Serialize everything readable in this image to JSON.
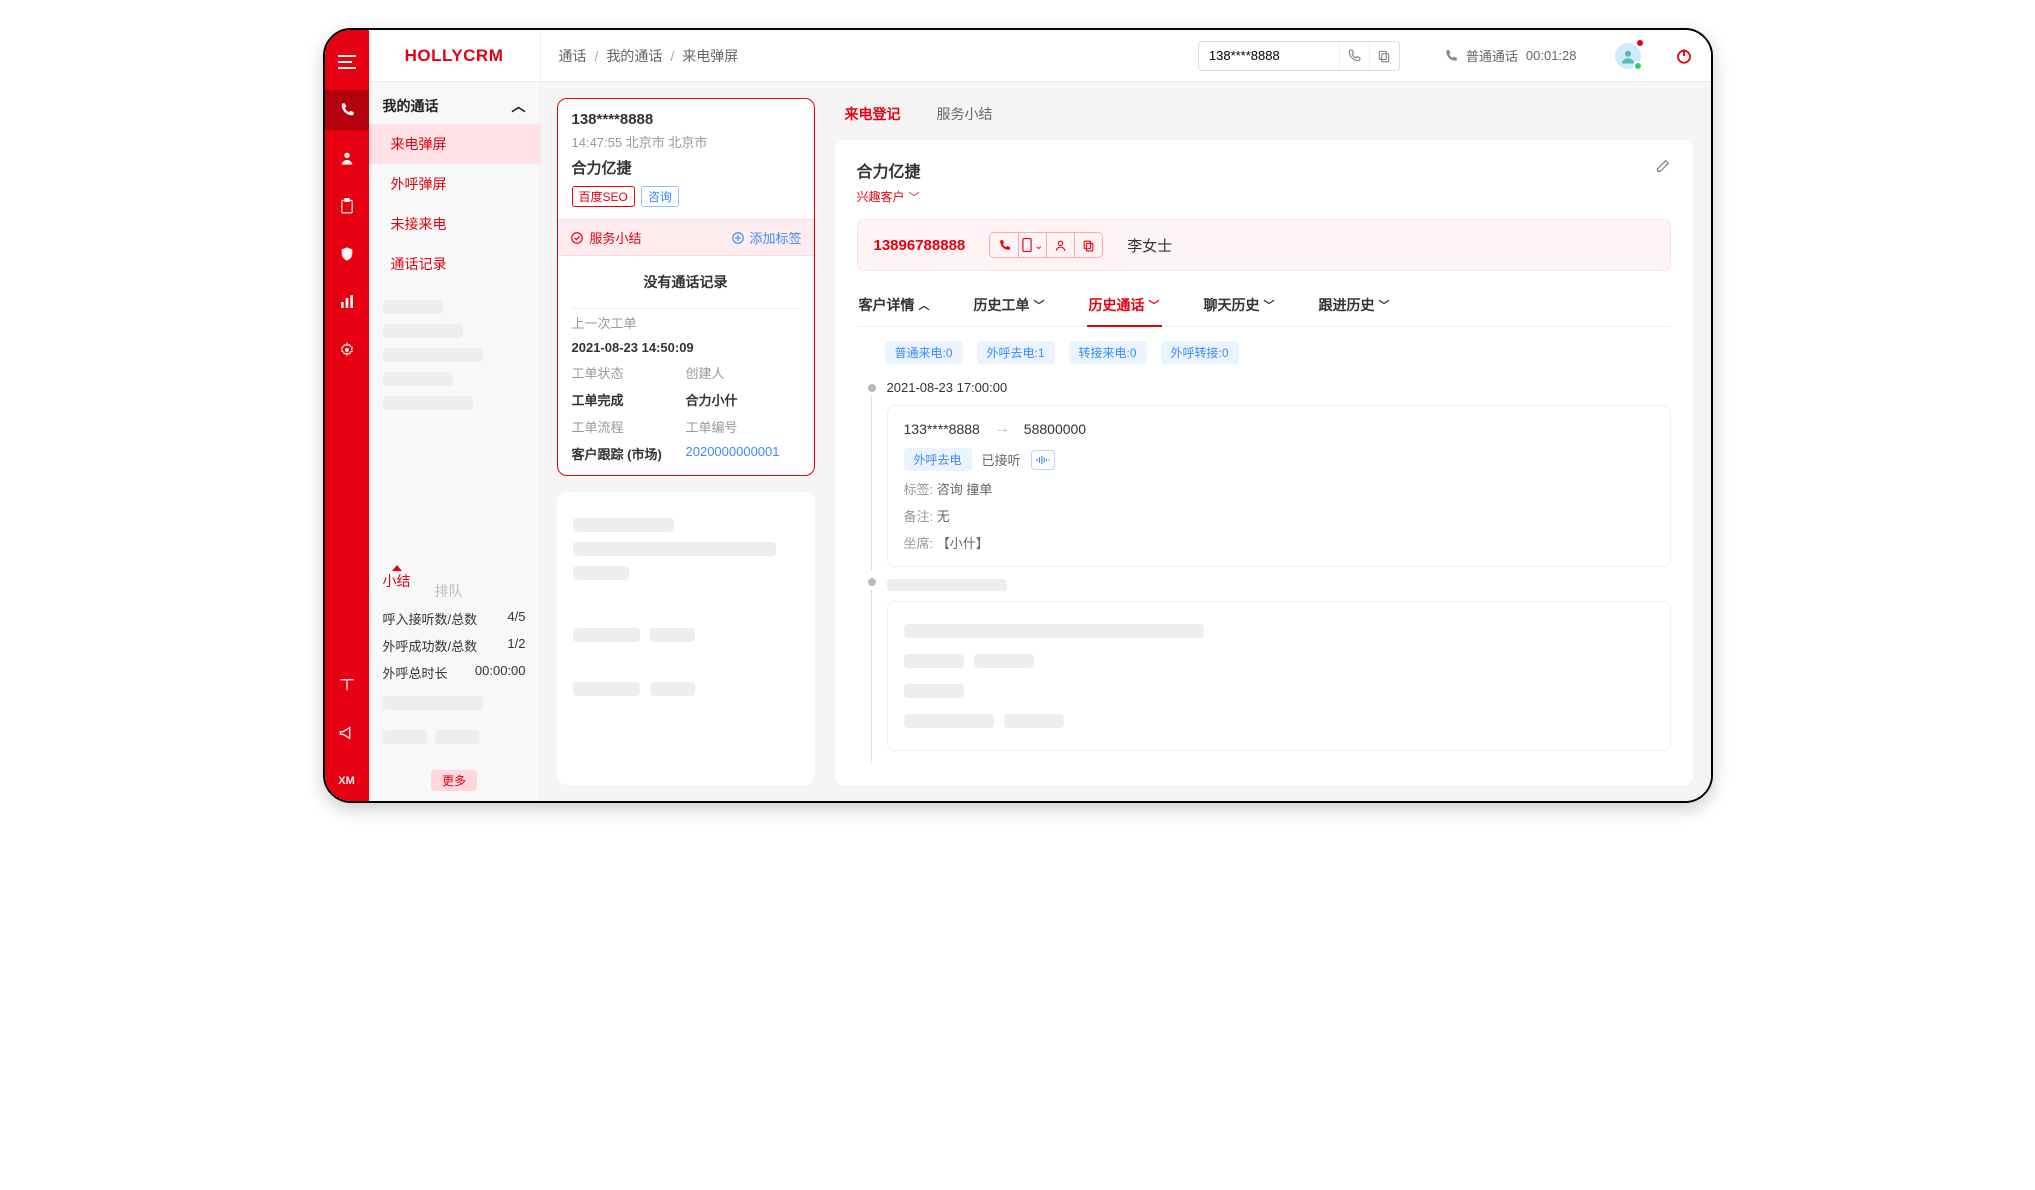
{
  "brand": "HOLLYCRM",
  "breadcrumbs": [
    "通话",
    "我的通话",
    "来电弹屏"
  ],
  "search_value": "138****8888",
  "call_status": {
    "label": "普通通话",
    "timer": "00:01:28"
  },
  "sidebar": {
    "group_title": "我的通话",
    "items": [
      "来电弹屏",
      "外呼弹屏",
      "未接来电",
      "通话记录"
    ]
  },
  "mini_tabs": {
    "summary": "小结",
    "queue": "排队"
  },
  "stats": {
    "r1_label": "呼入接听数/总数",
    "r1_value": "4/5",
    "r2_label": "外呼成功数/总数",
    "r2_value": "1/2",
    "r3_label": "外呼总时长",
    "r3_value": "00:00:00",
    "more": "更多"
  },
  "call_card": {
    "number": "138****8888",
    "time_loc": "14:47:55 北京市  北京市",
    "company": "合力亿捷",
    "tags": [
      "百度SEO",
      "咨询"
    ],
    "band_left": "服务小结",
    "band_right": "添加标签",
    "empty": "没有通话记录",
    "last_label": "上一次工单",
    "last_time": "2021-08-23 14:50:09",
    "k_status": "工单状态",
    "v_status_k": "创建人",
    "k_done": "工单完成",
    "v_done": "合力小什",
    "k_flow": "工单流程",
    "v_flow_k": "工单编号",
    "k_track": "客户跟踪 (市场)",
    "v_track": "2020000000001"
  },
  "top_tabs": {
    "reg": "来电登记",
    "sum": "服务小结"
  },
  "panel": {
    "title": "合力亿捷",
    "subtitle": "兴趣客户",
    "phone": "13896788888",
    "name": "李女士"
  },
  "subtabs": {
    "detail": "客户详情",
    "orders": "历史工单",
    "calls": "历史通话",
    "chats": "聊天历史",
    "follow": "跟进历史"
  },
  "chips": {
    "c1": "普通来电:0",
    "c2": "外呼去电:1",
    "c3": "转接来电:0",
    "c4": "外呼转接:0"
  },
  "timeline": {
    "time": "2021-08-23  17:00:00",
    "from": "133****8888",
    "to": "58800000",
    "badge": "外呼去电",
    "status": "已接听",
    "tags_label": "标签:",
    "tags_val": "咨询   撞单",
    "note_label": "备注:",
    "note_val": "无",
    "agent_label": "坐席:",
    "agent_val": "【小什】"
  }
}
